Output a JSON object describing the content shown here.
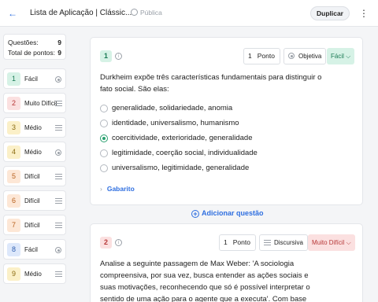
{
  "header": {
    "back_icon": "arrow-left-icon",
    "title": "Lista de Aplicação | Clássic...",
    "visibility": "Pública",
    "duplicate_label": "Duplicar",
    "more_icon": "kebab-menu-icon"
  },
  "summary": {
    "questions_label": "Questões:",
    "questions_value": "9",
    "points_label": "Total de pontos:",
    "points_value": "9"
  },
  "colors": {
    "accent": "#2f6fe0",
    "facil": "#d6f2e6",
    "muito_dificil": "#fbe0e0",
    "medio": "#fbf0c8",
    "dificil": "#fde7d6",
    "correct": "#2aa06f"
  },
  "questions": [
    {
      "num": "1",
      "label": "Fácil",
      "icon": "radio-icon"
    },
    {
      "num": "2",
      "label": "Muito Difícil",
      "icon": "lines-icon"
    },
    {
      "num": "3",
      "label": "Médio",
      "icon": "lines-icon"
    },
    {
      "num": "4",
      "label": "Médio",
      "icon": "radio-icon"
    },
    {
      "num": "5",
      "label": "Difícil",
      "icon": "lines-icon"
    },
    {
      "num": "6",
      "label": "Difícil",
      "icon": "lines-icon"
    },
    {
      "num": "7",
      "label": "Difícil",
      "icon": "lines-icon"
    },
    {
      "num": "8",
      "label": "Fácil",
      "icon": "radio-icon"
    },
    {
      "num": "9",
      "label": "Médio",
      "icon": "lines-icon"
    }
  ],
  "card1": {
    "num": "1",
    "points": "1",
    "points_unit": "Ponto",
    "type": "Objetiva",
    "difficulty": "Fácil ⌵",
    "stem": "Durkheim expõe três características fundamentais para distinguir o fato social. São elas:",
    "options": [
      {
        "text": "generalidade, solidariedade, anomia",
        "selected": false
      },
      {
        "text": "identidade, universalismo, humanismo",
        "selected": false
      },
      {
        "text": "coercitividade, exterioridade, generalidade",
        "selected": true
      },
      {
        "text": "legitimidade, coerção social, individualidade",
        "selected": false
      },
      {
        "text": "universalismo, legitimidade, generalidade",
        "selected": false
      }
    ],
    "answer_label": "Gabarito"
  },
  "add_question_label": "Adicionar questão",
  "card2": {
    "num": "2",
    "points": "1",
    "points_unit": "Ponto",
    "type": "Discursiva",
    "difficulty": "Muito Difícil ⌵",
    "stem": "Analise a seguinte passagem de Max Weber: 'A sociologia compreensiva, por sua vez, busca entender as ações sociais e suas motivações, reconhecendo que só é possível interpretar o sentido de uma ação para o agente que a executa'. Com base nisso e utilizando conhecimentos"
  }
}
